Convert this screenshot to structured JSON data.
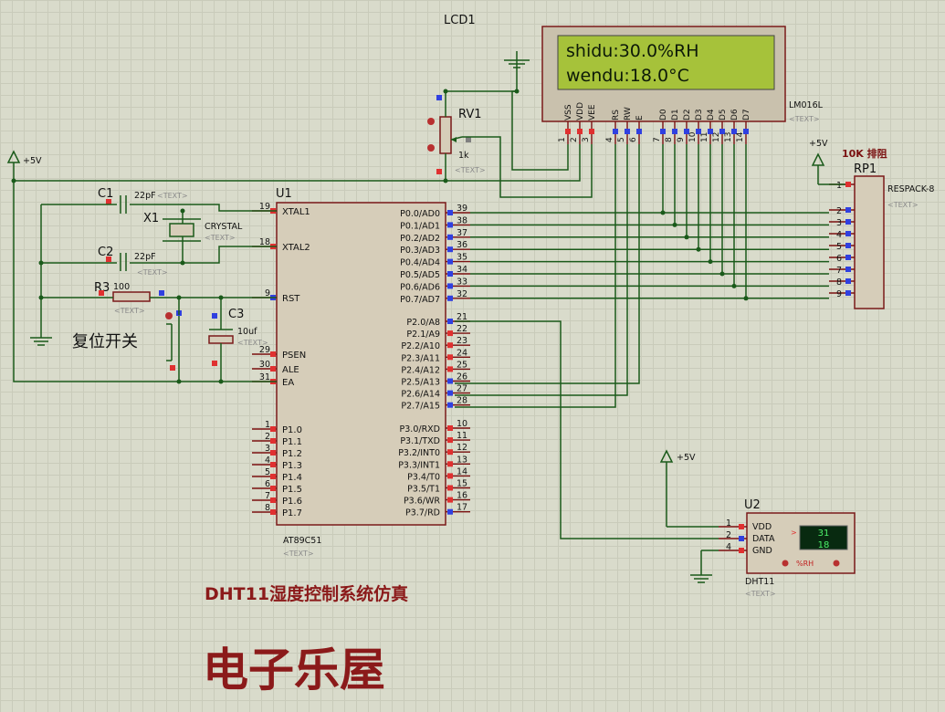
{
  "lcd": {
    "ref": "LCD1",
    "model": "LM016L",
    "line1": "shidu:30.0%RH",
    "line2": "wendu:18.0°C",
    "text": "<TEXT>",
    "pin_names": [
      "VSS",
      "VDD",
      "VEE",
      "RS",
      "RW",
      "E",
      "D0",
      "D1",
      "D2",
      "D3",
      "D4",
      "D5",
      "D6",
      "D7"
    ],
    "pin_nums": [
      "1",
      "2",
      "3",
      "4",
      "5",
      "6",
      "7",
      "8",
      "9",
      "10",
      "11",
      "12",
      "13",
      "14"
    ]
  },
  "rv1": {
    "ref": "RV1",
    "value": "1k",
    "text": "<TEXT>"
  },
  "u1": {
    "ref": "U1",
    "model": "AT89C51",
    "text": "<TEXT>",
    "left_pins": [
      {
        "num": "19",
        "name": "XTAL1"
      },
      {
        "num": "18",
        "name": "XTAL2"
      },
      {
        "num": "9",
        "name": "RST"
      },
      {
        "num": "29",
        "name": "PSEN"
      },
      {
        "num": "30",
        "name": "ALE"
      },
      {
        "num": "31",
        "name": "EA"
      },
      {
        "num": "1",
        "name": "P1.0"
      },
      {
        "num": "2",
        "name": "P1.1"
      },
      {
        "num": "3",
        "name": "P1.2"
      },
      {
        "num": "4",
        "name": "P1.3"
      },
      {
        "num": "5",
        "name": "P1.4"
      },
      {
        "num": "6",
        "name": "P1.5"
      },
      {
        "num": "7",
        "name": "P1.6"
      },
      {
        "num": "8",
        "name": "P1.7"
      }
    ],
    "p0_pins": [
      {
        "num": "39",
        "name": "P0.0/AD0"
      },
      {
        "num": "38",
        "name": "P0.1/AD1"
      },
      {
        "num": "37",
        "name": "P0.2/AD2"
      },
      {
        "num": "36",
        "name": "P0.3/AD3"
      },
      {
        "num": "35",
        "name": "P0.4/AD4"
      },
      {
        "num": "34",
        "name": "P0.5/AD5"
      },
      {
        "num": "33",
        "name": "P0.6/AD6"
      },
      {
        "num": "32",
        "name": "P0.7/AD7"
      }
    ],
    "p2_pins": [
      {
        "num": "21",
        "name": "P2.0/A8"
      },
      {
        "num": "22",
        "name": "P2.1/A9"
      },
      {
        "num": "23",
        "name": "P2.2/A10"
      },
      {
        "num": "24",
        "name": "P2.3/A11"
      },
      {
        "num": "25",
        "name": "P2.4/A12"
      },
      {
        "num": "26",
        "name": "P2.5/A13"
      },
      {
        "num": "27",
        "name": "P2.6/A14"
      },
      {
        "num": "28",
        "name": "P2.7/A15"
      }
    ],
    "p3_pins": [
      {
        "num": "10",
        "name": "P3.0/RXD"
      },
      {
        "num": "11",
        "name": "P3.1/TXD"
      },
      {
        "num": "12",
        "name": "P3.2/INT0"
      },
      {
        "num": "13",
        "name": "P3.3/INT1"
      },
      {
        "num": "14",
        "name": "P3.4/T0"
      },
      {
        "num": "15",
        "name": "P3.5/T1"
      },
      {
        "num": "16",
        "name": "P3.6/WR"
      },
      {
        "num": "17",
        "name": "P3.7/RD"
      }
    ]
  },
  "c1": {
    "ref": "C1",
    "value": "22pF",
    "text": "<TEXT>"
  },
  "c2": {
    "ref": "C2",
    "value": "22pF",
    "text": "<TEXT>"
  },
  "c3": {
    "ref": "C3",
    "value": "10uf",
    "text": "<TEXT>"
  },
  "x1": {
    "ref": "X1",
    "value": "CRYSTAL",
    "text": "<TEXT>"
  },
  "r3": {
    "ref": "R3",
    "value": "100",
    "text": "<TEXT>"
  },
  "reset_switch_label": "复位开关",
  "power_labels": [
    "+5V",
    "+5V",
    "+5V"
  ],
  "rp1": {
    "ref": "RP1",
    "model": "RESPACK-8",
    "note": "10K 排阻",
    "text": "<TEXT>",
    "pins": [
      "1",
      "2",
      "3",
      "4",
      "5",
      "6",
      "7",
      "8",
      "9"
    ]
  },
  "u2": {
    "ref": "U2",
    "model": "DHT11",
    "text": "<TEXT>",
    "pins": [
      {
        "num": "1",
        "name": "VDD"
      },
      {
        "num": "2",
        "name": "DATA"
      },
      {
        "num": "4",
        "name": "GND"
      }
    ],
    "display_top": "31",
    "display_bottom": "18",
    "unit_label": "%RH"
  },
  "title": "DHT11湿度控制系统仿真",
  "brand": "电子乐屋"
}
